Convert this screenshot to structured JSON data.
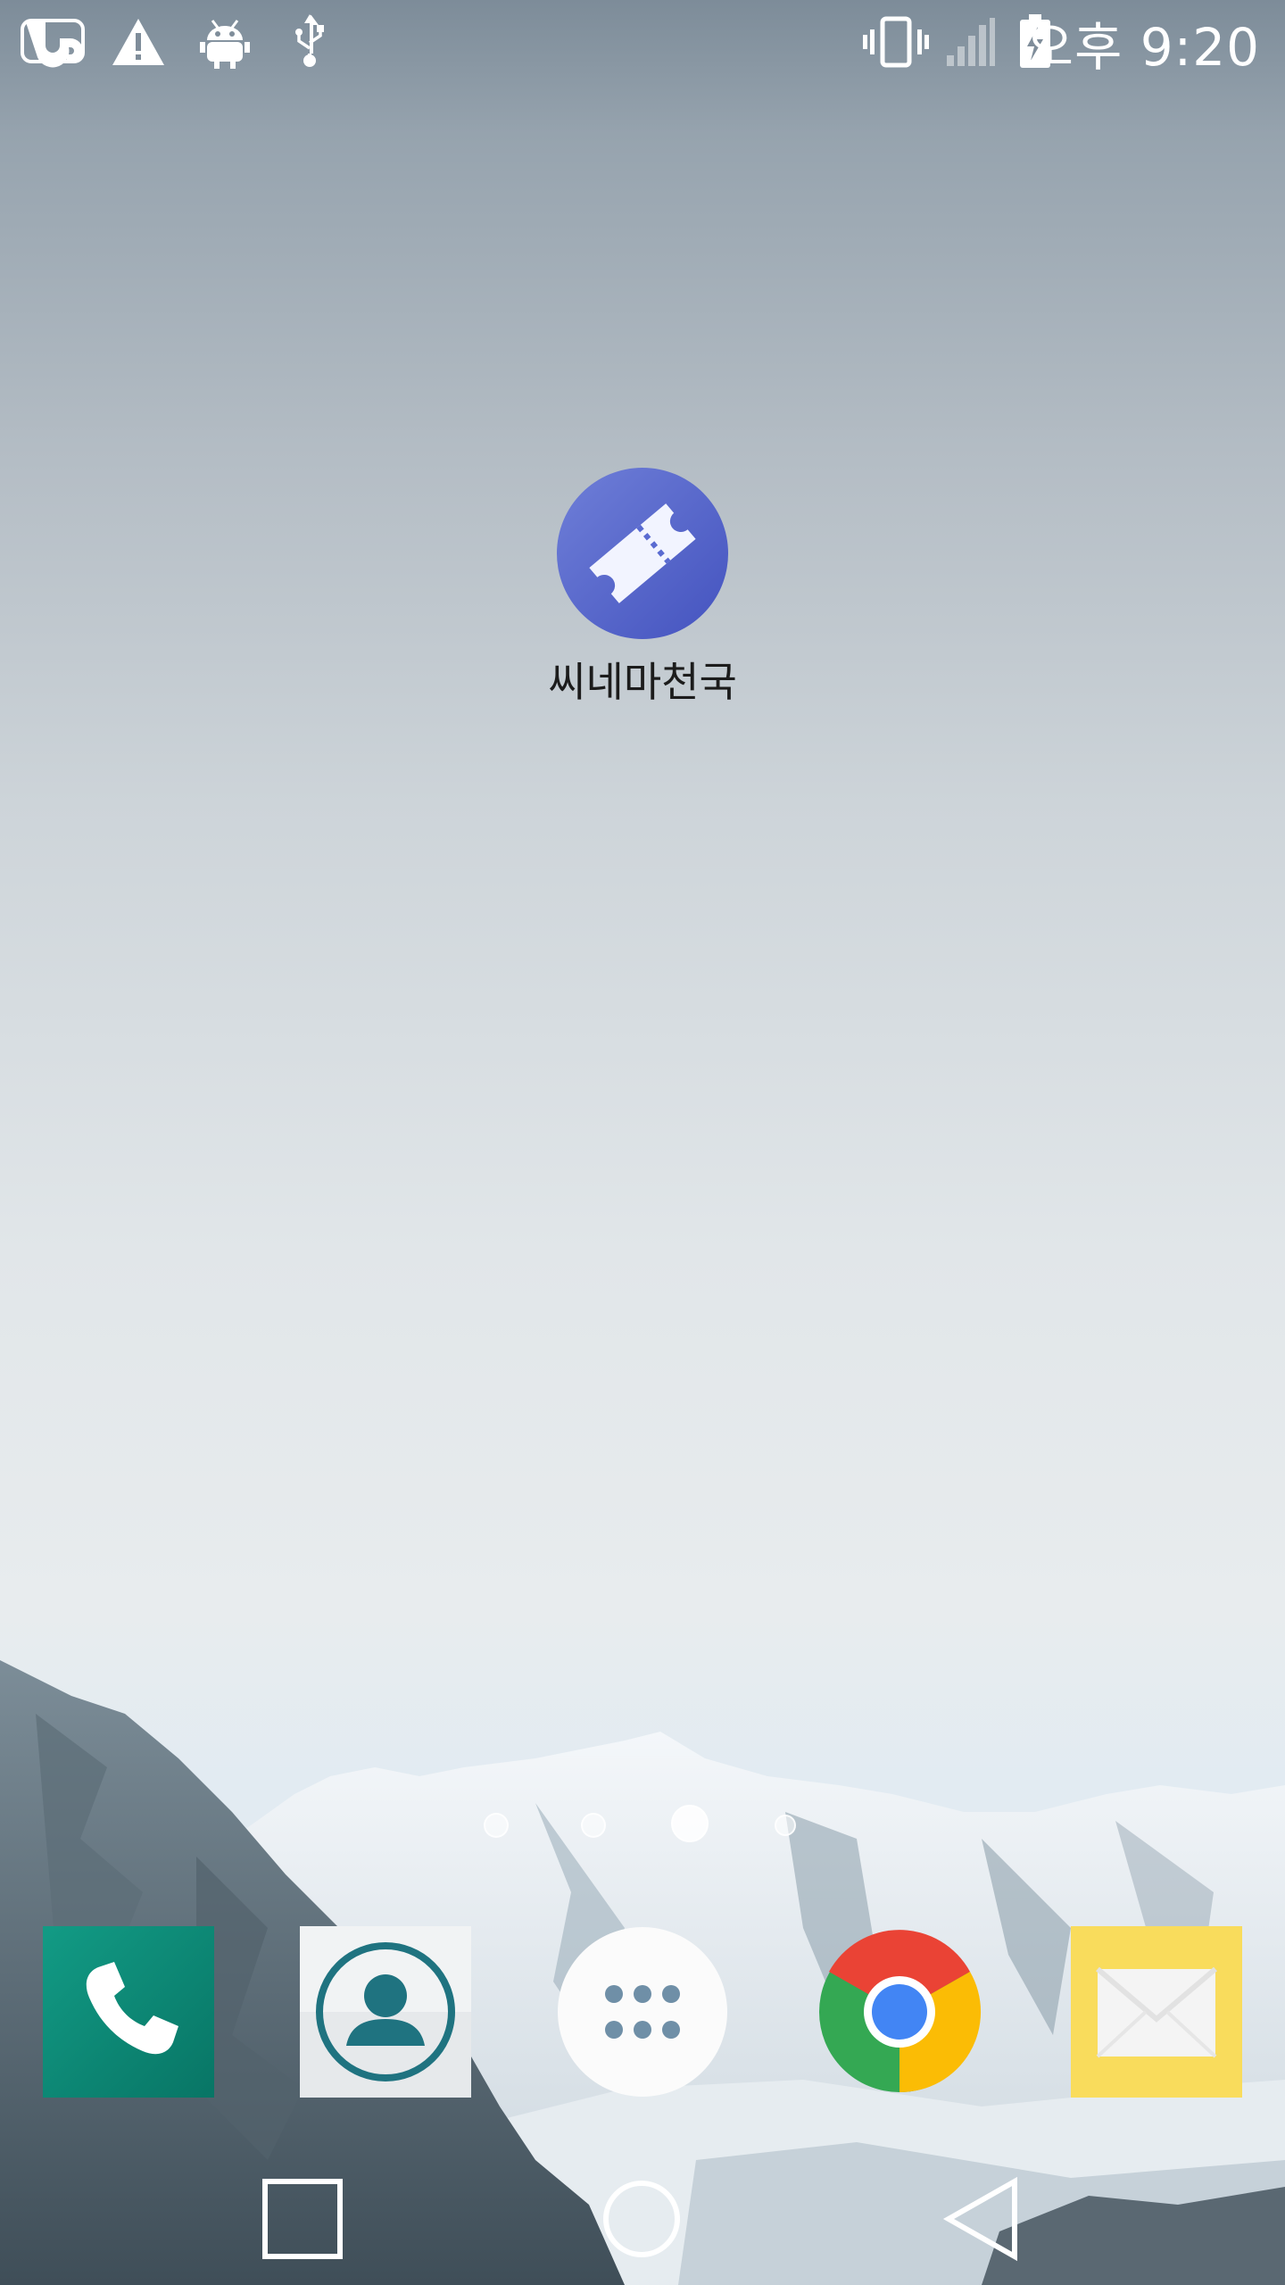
{
  "status_bar": {
    "icons": [
      "uplus-carrier-icon",
      "warning-icon",
      "android-debug-icon",
      "usb-icon",
      "vibrate-icon",
      "signal-icon",
      "battery-charging-icon"
    ],
    "time": "오후 9:20"
  },
  "home": {
    "apps": [
      {
        "label": "씨네마천국",
        "icon": "ticket-icon",
        "color": "#5a6bd1"
      }
    ],
    "page_indicator": {
      "pages": 4,
      "current": 3
    }
  },
  "dock": {
    "items": [
      {
        "name": "phone",
        "icon": "phone-icon",
        "color": "#0b8a7a"
      },
      {
        "name": "contacts",
        "icon": "contacts-icon",
        "color": "#1f7380"
      },
      {
        "name": "apps",
        "icon": "app-drawer-icon",
        "color": "#ffffff"
      },
      {
        "name": "chrome",
        "icon": "chrome-icon",
        "color": "#4285f4"
      },
      {
        "name": "email",
        "icon": "email-icon",
        "color": "#f9dc5c"
      }
    ]
  },
  "nav_bar": {
    "buttons": [
      "recent-apps-button",
      "home-button",
      "back-button"
    ]
  }
}
